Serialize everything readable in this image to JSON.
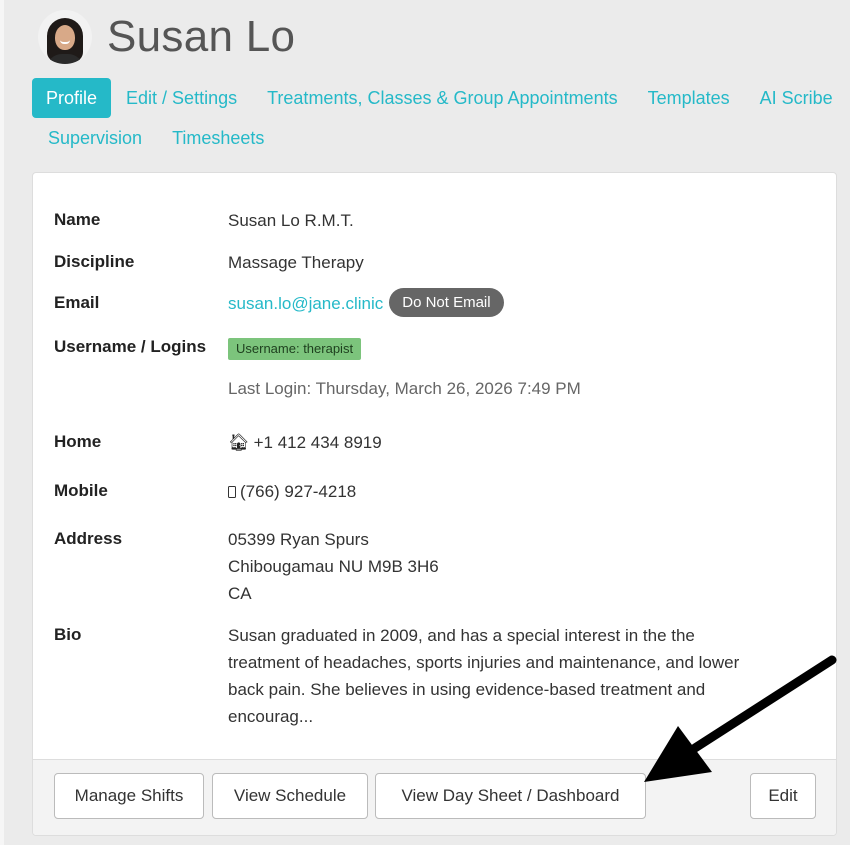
{
  "header": {
    "title": "Susan Lo"
  },
  "tabs": {
    "row1": [
      "Profile",
      "Edit / Settings",
      "Treatments, Classes & Group Appointments",
      "Templates",
      "AI Scribe"
    ],
    "row2": [
      "Supervision",
      "Timesheets"
    ],
    "active": "Profile"
  },
  "profile": {
    "name_label": "Name",
    "name_value": "Susan Lo R.M.T.",
    "discipline_label": "Discipline",
    "discipline_value": "Massage Therapy",
    "email_label": "Email",
    "email_value": "susan.lo@jane.clinic",
    "email_badge": "Do Not Email",
    "username_label": "Username / Logins",
    "username_tag": "Username: therapist",
    "last_login": "Last Login: Thursday, March 26, 2026 7:49 PM",
    "home_label": "Home",
    "home_value": "+1 412 434 8919",
    "mobile_label": "Mobile",
    "mobile_value": "(766) 927-4218",
    "address_label": "Address",
    "address_line1": "05399 Ryan Spurs",
    "address_line2": "Chibougamau NU M9B 3H6",
    "address_line3": "CA",
    "bio_label": "Bio",
    "bio_line1": "Susan graduated in 2009, and has a special interest in the the",
    "bio_line2": "treatment of headaches, sports injuries and maintenance, and lower",
    "bio_line3": "back pain. She believes in using evidence-based treatment and",
    "bio_line4": "encourag..."
  },
  "footer": {
    "manage_shifts": "Manage Shifts",
    "view_schedule": "View Schedule",
    "view_day_sheet": "View Day Sheet / Dashboard",
    "edit": "Edit"
  },
  "icons": {
    "home": "home-icon",
    "mobile": "mobile-phone-icon",
    "annotation": "arrow-icon"
  },
  "colors": {
    "accent": "#25b9c8",
    "badge_gray": "#666666",
    "tag_green": "#7cc47c"
  }
}
